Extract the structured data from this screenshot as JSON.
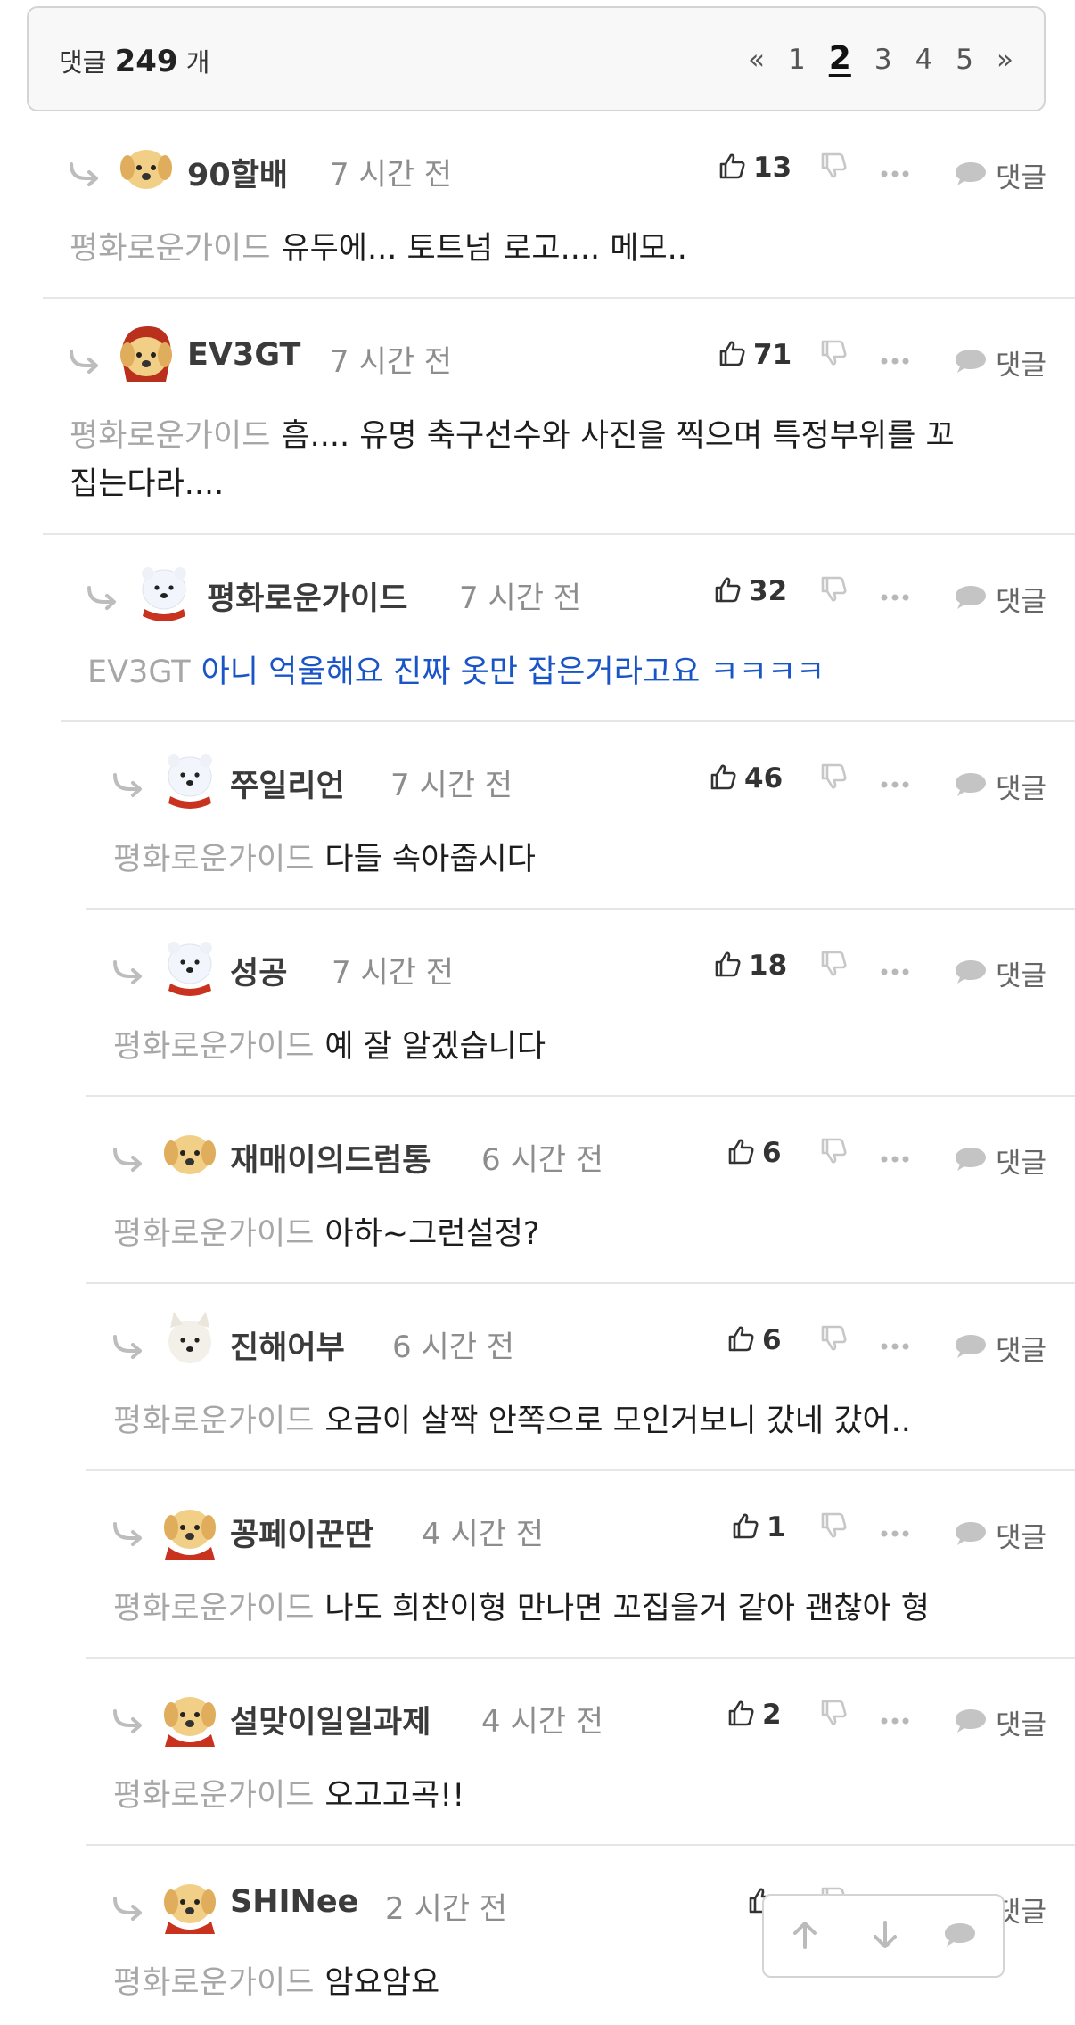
{
  "header": {
    "count_label": "댓글",
    "count_value": "249",
    "count_unit": "개",
    "pager": {
      "first": "«",
      "pages": [
        "1",
        "2",
        "3",
        "4",
        "5"
      ],
      "current": "2",
      "last": "»"
    }
  },
  "reply_label": "댓글",
  "comments": [
    {
      "author": "90할배",
      "time": "7 시간 전",
      "likes": "13",
      "mention": "평화로운가이드",
      "text": "유두에... 토트넘 로고.... 메모..",
      "avatar": "puppy"
    },
    {
      "author": "EV3GT",
      "time": "7 시간 전",
      "likes": "71",
      "mention": "평화로운가이드",
      "text": "흠.... 유명 축구선수와 사진을 찍으며 특정부위를 꼬",
      "text2": "집는다라....",
      "avatar": "red-hood-puppy"
    },
    {
      "author": "평화로운가이드",
      "time": "7 시간 전",
      "likes": "32",
      "mention": "EV3GT",
      "text": "아니 억울해요 진짜 옷만 잡은거라고요 ㅋㅋㅋㅋ",
      "avatar": "white-bear-red-scarf"
    },
    {
      "author": "쭈일리언",
      "time": "7 시간 전",
      "likes": "46",
      "mention": "평화로운가이드",
      "text": "다들 속아줍시다",
      "avatar": "white-bear-red-scarf"
    },
    {
      "author": "성공",
      "time": "7 시간 전",
      "likes": "18",
      "mention": "평화로운가이드",
      "text": "예 잘 알겠습니다",
      "avatar": "white-bear-red-scarf"
    },
    {
      "author": "재매이의드럼통",
      "time": "6 시간 전",
      "likes": "6",
      "mention": "평화로운가이드",
      "text": "아하~그런설정?",
      "avatar": "puppy"
    },
    {
      "author": "진해어부",
      "time": "6 시간 전",
      "likes": "6",
      "mention": "평화로운가이드",
      "text": "오금이 살짝 안쪽으로 모인거보니 갔네 갔어..",
      "avatar": "white-dog"
    },
    {
      "author": "꽁페이꾼딴",
      "time": "4 시간 전",
      "likes": "1",
      "mention": "평화로운가이드",
      "text": "나도 희찬이형 만나면 꼬집을거 같아 괜찮아 형",
      "avatar": "puppy-red-cape"
    },
    {
      "author": "설맞이일일과제",
      "time": "4 시간 전",
      "likes": "2",
      "mention": "평화로운가이드",
      "text": "오고고곡!!",
      "avatar": "puppy-red-cape"
    },
    {
      "author": "SHINee",
      "time": "2 시간 전",
      "likes": "",
      "mention": "평화로운가이드",
      "text": "암요암요",
      "avatar": "puppy-red-cape"
    }
  ],
  "colors": {
    "mention": "#a7a7a7",
    "highlight_text": "#1a55c8",
    "divider": "#e6e6e6",
    "header_bg": "#f8f8f8"
  },
  "icons": [
    "reply-arrow-icon",
    "thumbs-up-icon",
    "thumbs-down-icon",
    "more-icon",
    "speech-bubble-icon",
    "arrow-up-icon",
    "arrow-down-icon"
  ]
}
